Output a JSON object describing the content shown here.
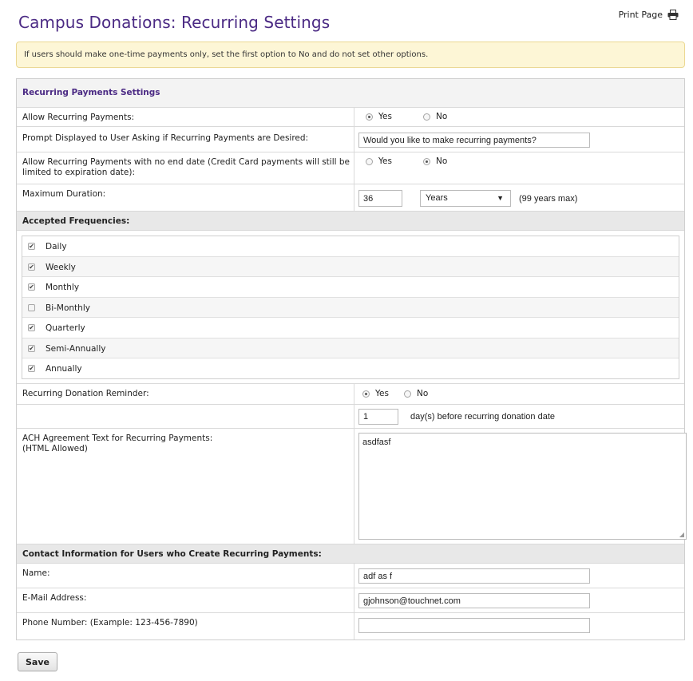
{
  "header": {
    "title": "Campus Donations: Recurring Settings",
    "print_label": "Print Page",
    "print_icon": "printer-icon"
  },
  "notice": "If users should make one-time payments only, set the first option to No and do not set other options.",
  "settings": {
    "section_title": "Recurring Payments Settings",
    "allow_recurring": {
      "label": "Allow Recurring Payments:",
      "yes": "Yes",
      "no": "No",
      "selected": "Yes"
    },
    "prompt": {
      "label": "Prompt Displayed to User Asking if Recurring Payments are Desired:",
      "value": "Would you like to make recurring payments?"
    },
    "no_end_date": {
      "label": "Allow Recurring Payments with no end date (Credit Card payments will still be limited to expiration date):",
      "yes": "Yes",
      "no": "No",
      "selected": "No"
    },
    "max_duration": {
      "label": "Maximum Duration:",
      "value": "36",
      "unit": "Years",
      "hint": "(99 years max)"
    }
  },
  "frequencies": {
    "title": "Accepted Frequencies:",
    "items": [
      {
        "label": "Daily",
        "checked": true
      },
      {
        "label": "Weekly",
        "checked": true
      },
      {
        "label": "Monthly",
        "checked": true
      },
      {
        "label": "Bi-Monthly",
        "checked": false
      },
      {
        "label": "Quarterly",
        "checked": true
      },
      {
        "label": "Semi-Annually",
        "checked": true
      },
      {
        "label": "Annually",
        "checked": true
      }
    ]
  },
  "reminder": {
    "label": "Recurring Donation Reminder:",
    "yes": "Yes",
    "no": "No",
    "selected": "Yes",
    "days_value": "1",
    "days_suffix": "day(s) before recurring donation date"
  },
  "ach": {
    "label_line1": "ACH Agreement Text for Recurring Payments:",
    "label_line2": "(HTML Allowed)",
    "value": "asdfasf"
  },
  "contact": {
    "title": "Contact Information for Users who Create Recurring Payments:",
    "name_label": "Name:",
    "name_value": "adf as f",
    "email_label": "E-Mail Address:",
    "email_value": "gjohnson@touchnet.com",
    "phone_label": "Phone Number: (Example: 123-456-7890)",
    "phone_value": ""
  },
  "save_label": "Save"
}
